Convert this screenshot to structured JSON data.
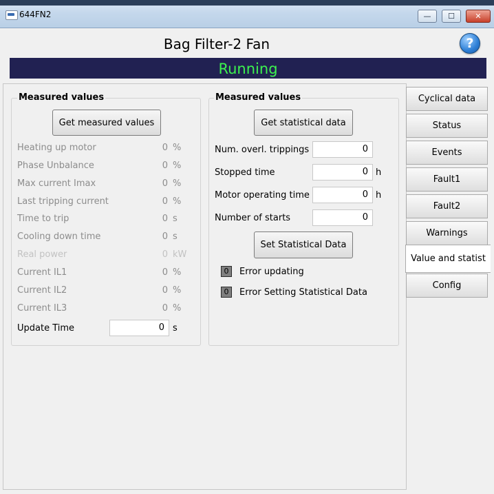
{
  "window": {
    "title": "644FN2",
    "min_glyph": "—",
    "max_glyph": "☐",
    "close_glyph": "✕"
  },
  "header": {
    "title": "Bag Filter-2 Fan",
    "help_glyph": "?"
  },
  "status": {
    "text": "Running",
    "color": "#3df24f"
  },
  "left_group": {
    "title": "Measured values",
    "button_label": "Get measured values",
    "rows": [
      {
        "label": "Heating up motor",
        "value": "0",
        "unit": "%"
      },
      {
        "label": "Phase Unbalance",
        "value": "0",
        "unit": "%"
      },
      {
        "label": "Max current Imax",
        "value": "0",
        "unit": "%"
      },
      {
        "label": "Last tripping current",
        "value": "0",
        "unit": "%"
      },
      {
        "label": "Time to trip",
        "value": "0",
        "unit": "s"
      },
      {
        "label": "Cooling down time",
        "value": "0",
        "unit": "s"
      },
      {
        "label": "Real power",
        "value": "0",
        "unit": "kW"
      },
      {
        "label": "Current IL1",
        "value": "0",
        "unit": "%"
      },
      {
        "label": "Current IL2",
        "value": "0",
        "unit": "%"
      },
      {
        "label": "Current IL3",
        "value": "0",
        "unit": "%"
      }
    ],
    "update_time": {
      "label": "Update Time",
      "value": "0",
      "unit": "s"
    }
  },
  "right_group": {
    "title": "Measured values",
    "get_button_label": "Get statistical data",
    "fields": [
      {
        "label": "Num. overl. trippings",
        "value": "0",
        "unit": ""
      },
      {
        "label": "Stopped time",
        "value": "0",
        "unit": "h"
      },
      {
        "label": "Motor operating time",
        "value": "0",
        "unit": "h"
      },
      {
        "label": "Number of starts",
        "value": "0",
        "unit": ""
      }
    ],
    "set_button_label": "Set Statistical Data",
    "indicators": [
      {
        "value": "0",
        "label": "Error updating"
      },
      {
        "value": "0",
        "label": "Error Setting Statistical Data"
      }
    ]
  },
  "tabs": [
    {
      "label": "Cyclical data",
      "active": false
    },
    {
      "label": "Status",
      "active": false
    },
    {
      "label": "Events",
      "active": false
    },
    {
      "label": "Fault1",
      "active": false
    },
    {
      "label": "Fault2",
      "active": false
    },
    {
      "label": "Warnings",
      "active": false
    },
    {
      "label": "Value and statist",
      "active": true
    },
    {
      "label": "Config",
      "active": false
    }
  ]
}
